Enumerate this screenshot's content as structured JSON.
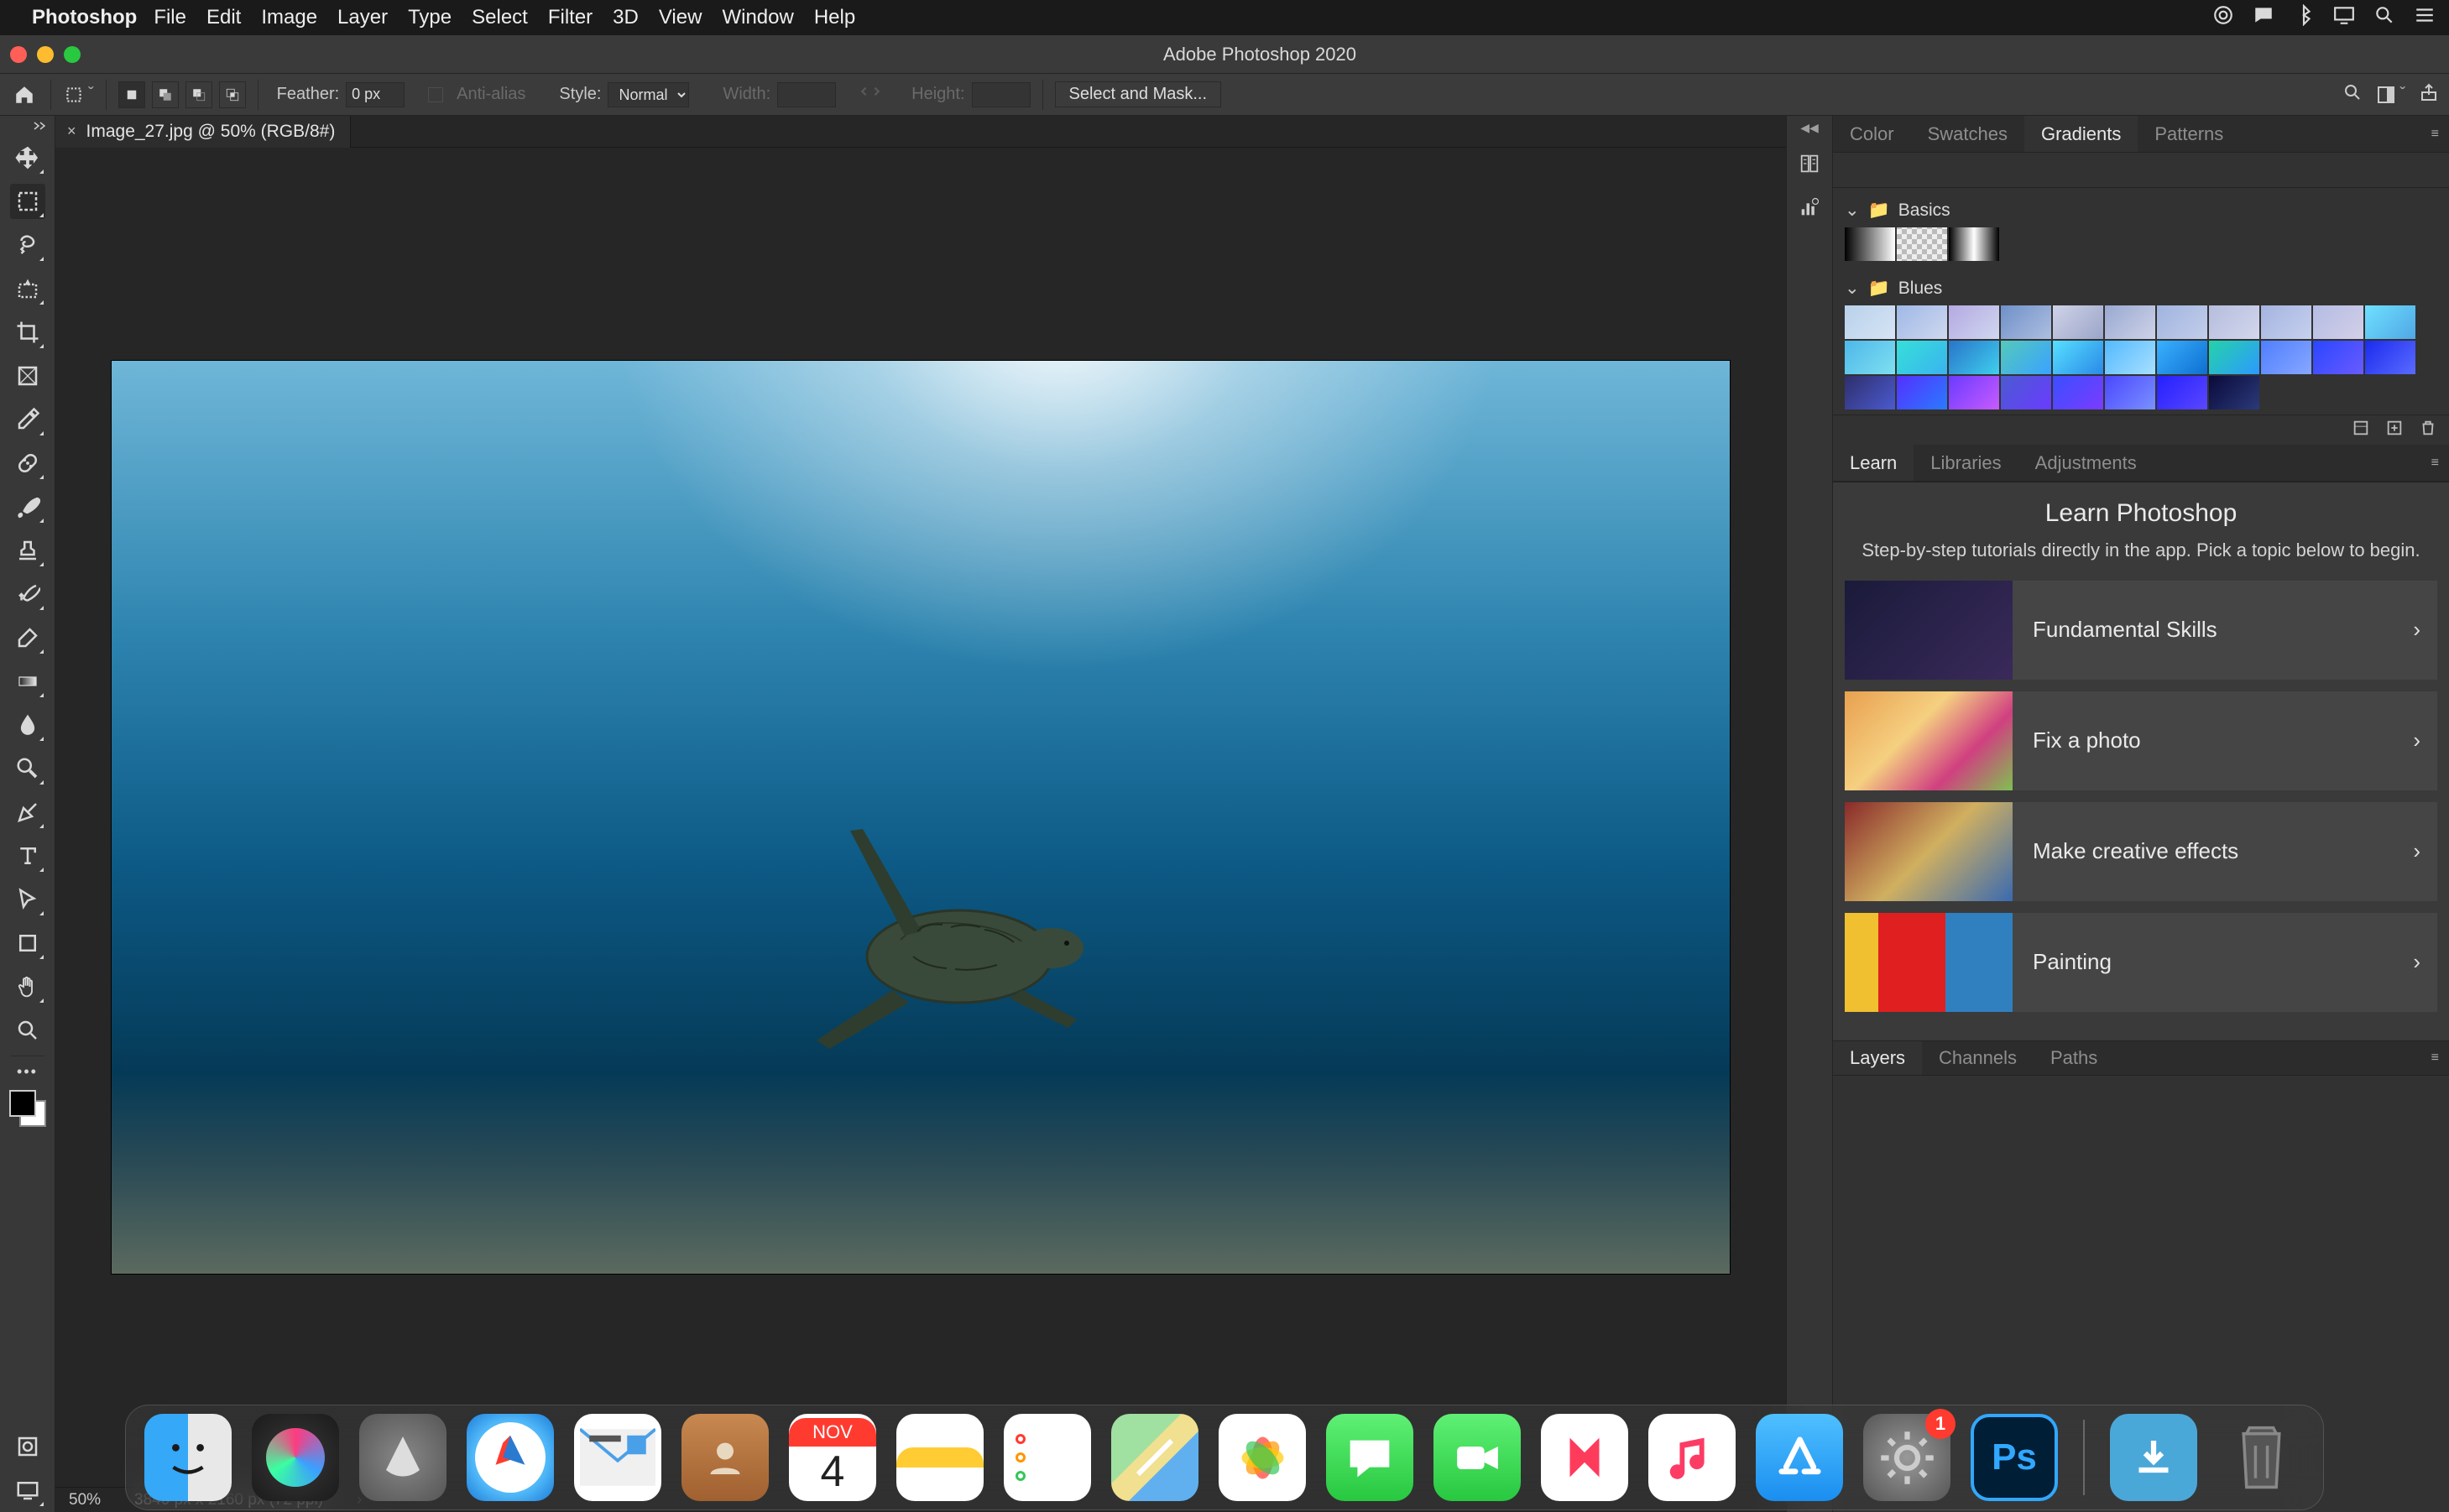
{
  "menubar": {
    "app": "Photoshop",
    "items": [
      "File",
      "Edit",
      "Image",
      "Layer",
      "Type",
      "Select",
      "Filter",
      "3D",
      "View",
      "Window",
      "Help"
    ]
  },
  "window": {
    "title": "Adobe Photoshop 2020"
  },
  "optbar": {
    "feather_label": "Feather:",
    "feather_value": "0 px",
    "antialias": "Anti-alias",
    "style_label": "Style:",
    "style_value": "Normal",
    "width_label": "Width:",
    "height_label": "Height:",
    "mask_btn": "Select and Mask..."
  },
  "doc_tab": {
    "title": "Image_27.jpg @ 50% (RGB/8#)"
  },
  "status": {
    "zoom": "50%",
    "info": "3840 px x 2160 px (72 ppi)"
  },
  "panels": {
    "top_tabs": [
      "Color",
      "Swatches",
      "Gradients",
      "Patterns"
    ],
    "top_active": "Gradients",
    "gradient_groups": [
      {
        "name": "Basics",
        "thumbs": [
          "linear-gradient(90deg,#000,#fff)",
          "repeating-conic-gradient(#bbb 0 25%,#eee 0 50%) 0/12px 12px",
          "linear-gradient(90deg,#000,#fff,#000)"
        ]
      },
      {
        "name": "Blues",
        "thumbs": [
          "linear-gradient(135deg,#b9d1ea,#d6e4f5)",
          "linear-gradient(135deg,#9fb9e6,#cfd7ef)",
          "linear-gradient(135deg,#b4a9e2,#d0d7f0)",
          "linear-gradient(135deg,#6f90c9,#aebfe0)",
          "linear-gradient(135deg,#d0d3e8,#9aa5c9)",
          "linear-gradient(135deg,#9aa9d1,#cdd2e8)",
          "linear-gradient(135deg,#a0b4df,#c3cdea)",
          "linear-gradient(135deg,#b5bdde,#d3d7ec)",
          "linear-gradient(135deg,#a5b4e0,#c6d0ee)",
          "linear-gradient(135deg,#b4bce4,#d3cfe8)",
          "linear-gradient(135deg,#6fe0ff,#4fa7e5)",
          "linear-gradient(135deg,#4db7e8,#7fe0f2)",
          "linear-gradient(135deg,#35e0d9,#3bb3ef)",
          "linear-gradient(135deg,#2a74c9,#3ed0ee)",
          "linear-gradient(135deg,#55c9ba,#39a3ff)",
          "linear-gradient(135deg,#57e0ff,#2a89e8)",
          "linear-gradient(135deg,#53b9ff,#a7e0ff)",
          "linear-gradient(135deg,#3ab1ff,#0e6fd0)",
          "linear-gradient(135deg,#24d3a8,#2d99ff)",
          "linear-gradient(135deg,#4f7fff,#87a7ff)",
          "linear-gradient(135deg,#2946ff,#6a5bff)",
          "linear-gradient(135deg,#1b2bee,#5a6bff)",
          "linear-gradient(135deg,#2f2e6b,#4a5bd0)",
          "linear-gradient(135deg,#5430ff,#2a7bff)",
          "linear-gradient(135deg,#6a3bff,#c85bff)",
          "linear-gradient(135deg,#4b5bd0,#6a3bff)",
          "linear-gradient(135deg,#3a4fff,#7b3bff)",
          "linear-gradient(135deg,#4b47ff,#7a91ff)",
          "linear-gradient(135deg,#2420ff,#5a47ff)",
          "linear-gradient(135deg,#0a0a3a,#2b3a7a)"
        ]
      }
    ],
    "mid_tabs": [
      "Learn",
      "Libraries",
      "Adjustments"
    ],
    "mid_active": "Learn",
    "learn": {
      "title": "Learn Photoshop",
      "subtitle": "Step-by-step tutorials directly in the app. Pick a topic below to begin.",
      "items": [
        "Fundamental Skills",
        "Fix a photo",
        "Make creative effects",
        "Painting"
      ]
    },
    "bottom_tabs": [
      "Layers",
      "Channels",
      "Paths"
    ],
    "bottom_active": "Layers"
  },
  "dock": {
    "icons": [
      "finder",
      "siri",
      "launchpad",
      "safari",
      "mail",
      "contacts",
      "calendar",
      "notes",
      "reminders",
      "maps",
      "photos",
      "messages",
      "facetime",
      "news",
      "music",
      "appstore",
      "preferences",
      "photoshop"
    ],
    "calendar": {
      "month": "NOV",
      "day": "4"
    },
    "ps_badge": "1"
  }
}
